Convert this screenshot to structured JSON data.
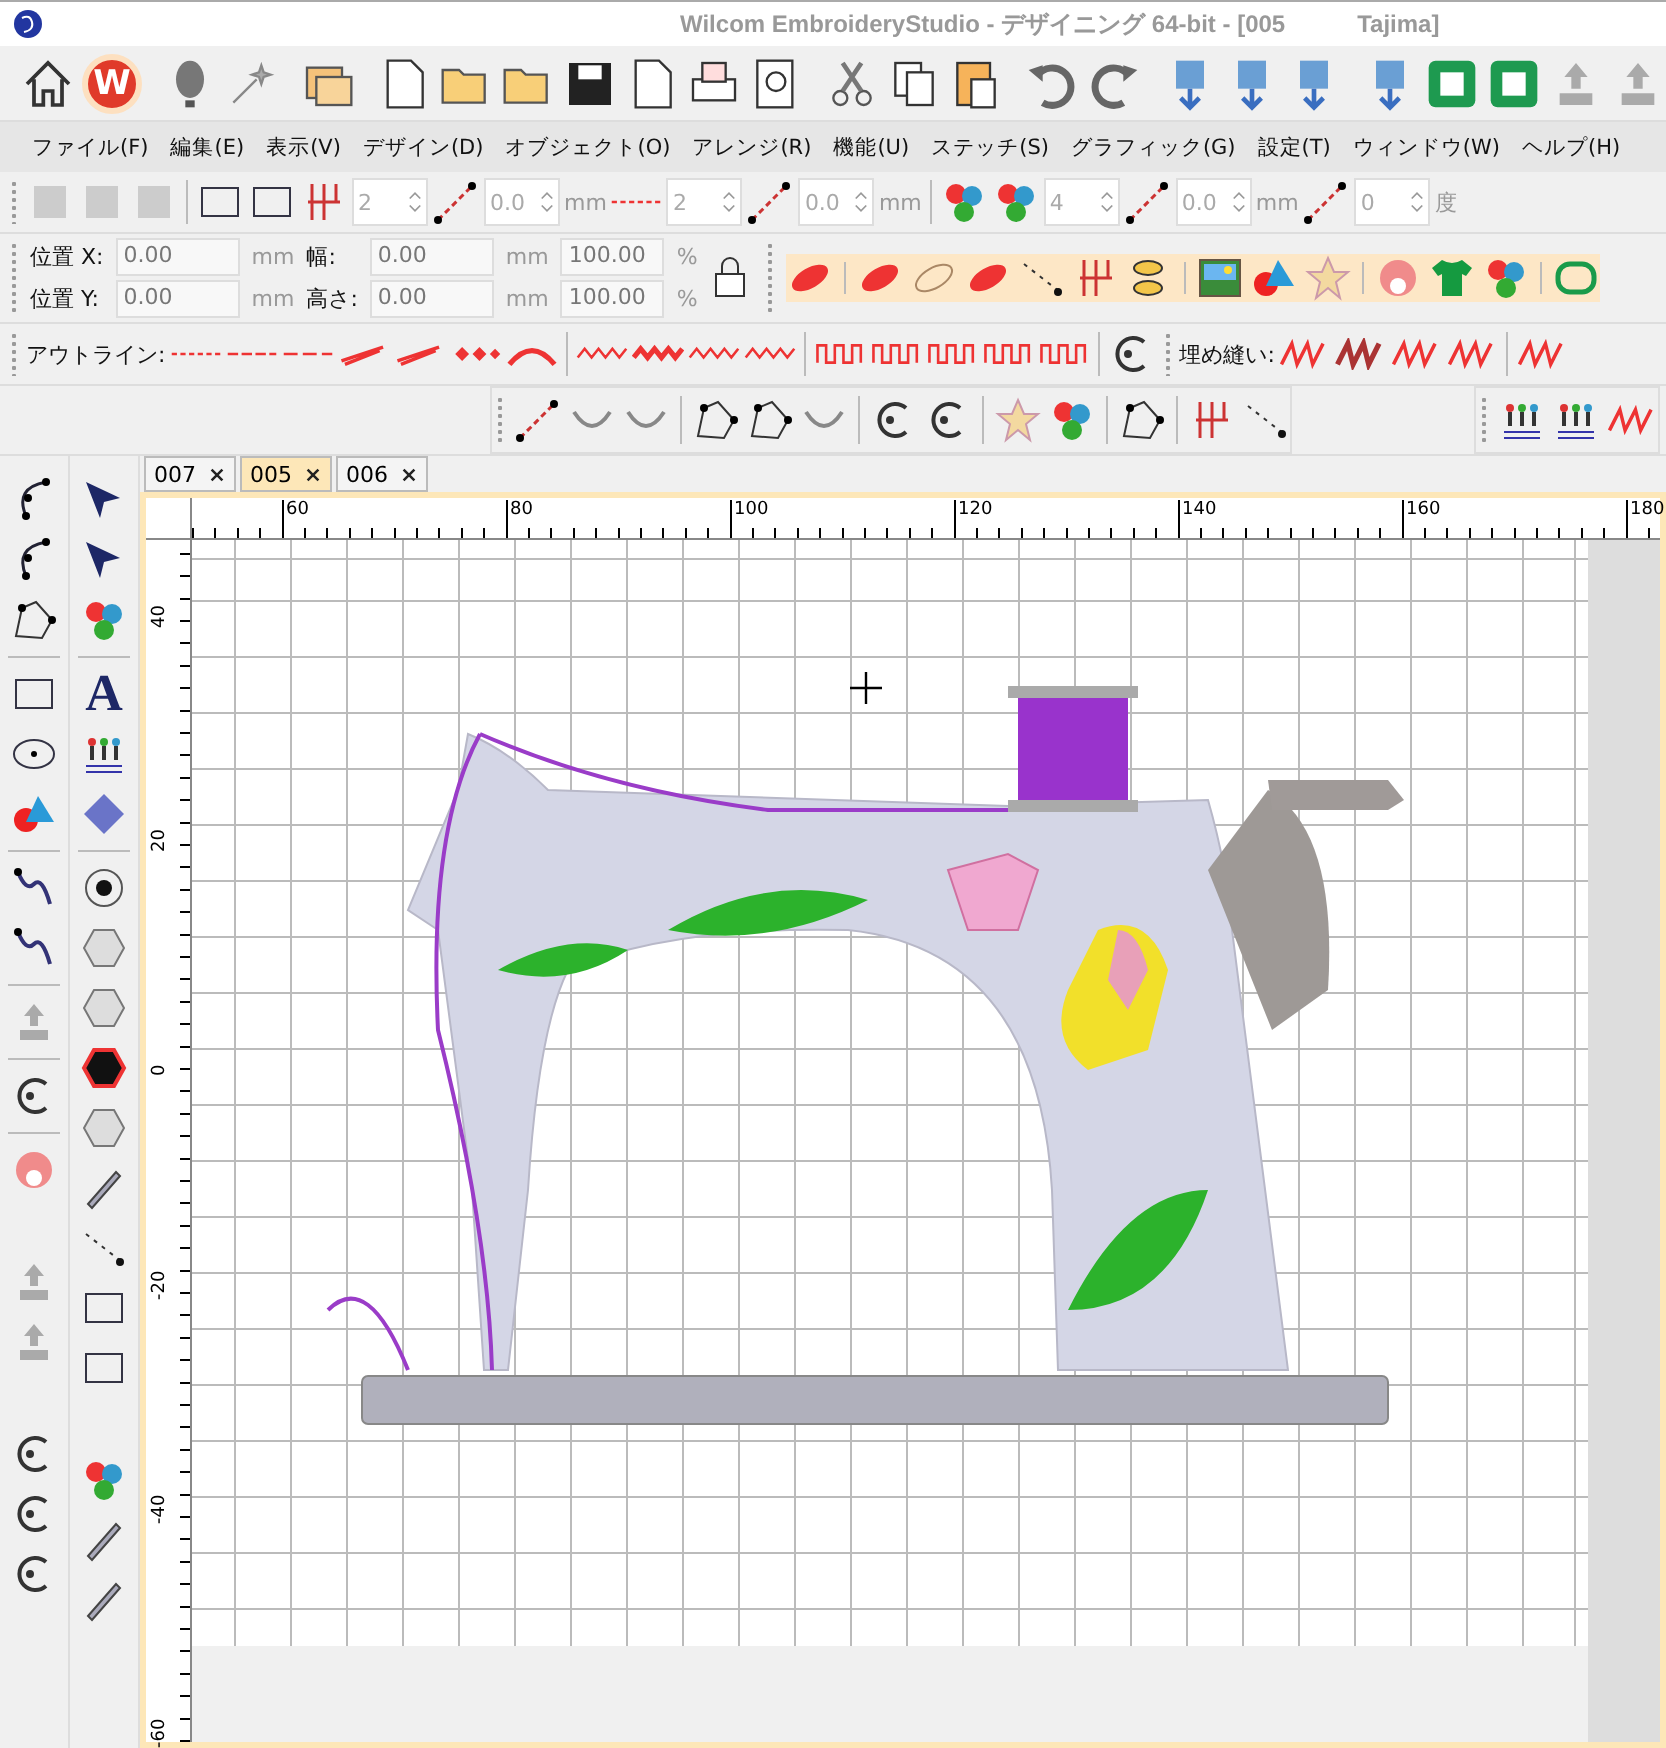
{
  "window": {
    "title": "Wilcom EmbroideryStudio - デザイニング 64-bit - [005",
    "title_suffix": "Tajima]"
  },
  "logo_button": {
    "label": "W"
  },
  "menu": [
    "ファイル(F)",
    "編集(E)",
    "表示(V)",
    "デザイン(D)",
    "オブジェクト(O)",
    "アレンジ(R)",
    "機能(U)",
    "ステッチ(S)",
    "グラフィック(G)",
    "設定(T)",
    "ウィンドウ(W)",
    "ヘルプ(H)"
  ],
  "stitch_params": [
    {
      "value": "2"
    },
    {
      "value": "0.0",
      "unit": "mm"
    },
    {
      "value": "2"
    },
    {
      "value": "0.0",
      "unit": "mm"
    },
    {
      "value": "4"
    },
    {
      "value": "0.0",
      "unit": "mm"
    },
    {
      "value": "0",
      "unit": "度"
    }
  ],
  "position_bar": {
    "rows": [
      {
        "label": "位置 X:",
        "value": "0.00",
        "unit": "mm",
        "size_label": "幅:",
        "size_value": "0.00",
        "size_unit": "mm",
        "scale": "100.00",
        "scale_unit": "%"
      },
      {
        "label": "位置 Y:",
        "value": "0.00",
        "unit": "mm",
        "size_label": "高さ:",
        "size_value": "0.00",
        "size_unit": "mm",
        "scale": "100.00",
        "scale_unit": "%"
      }
    ]
  },
  "outline_label": "アウトライン:",
  "fill_label": "埋め縫い:",
  "text_tool_glyph": "A",
  "tabs": [
    {
      "label": "007",
      "selected": false
    },
    {
      "label": "005",
      "selected": true
    },
    {
      "label": "006",
      "selected": false
    }
  ],
  "ruler": {
    "horizontal": [
      "60",
      "80",
      "100",
      "120",
      "140",
      "160",
      "180"
    ],
    "vertical": [
      "40",
      "20",
      "0",
      "-20",
      "-40",
      "-60"
    ]
  }
}
